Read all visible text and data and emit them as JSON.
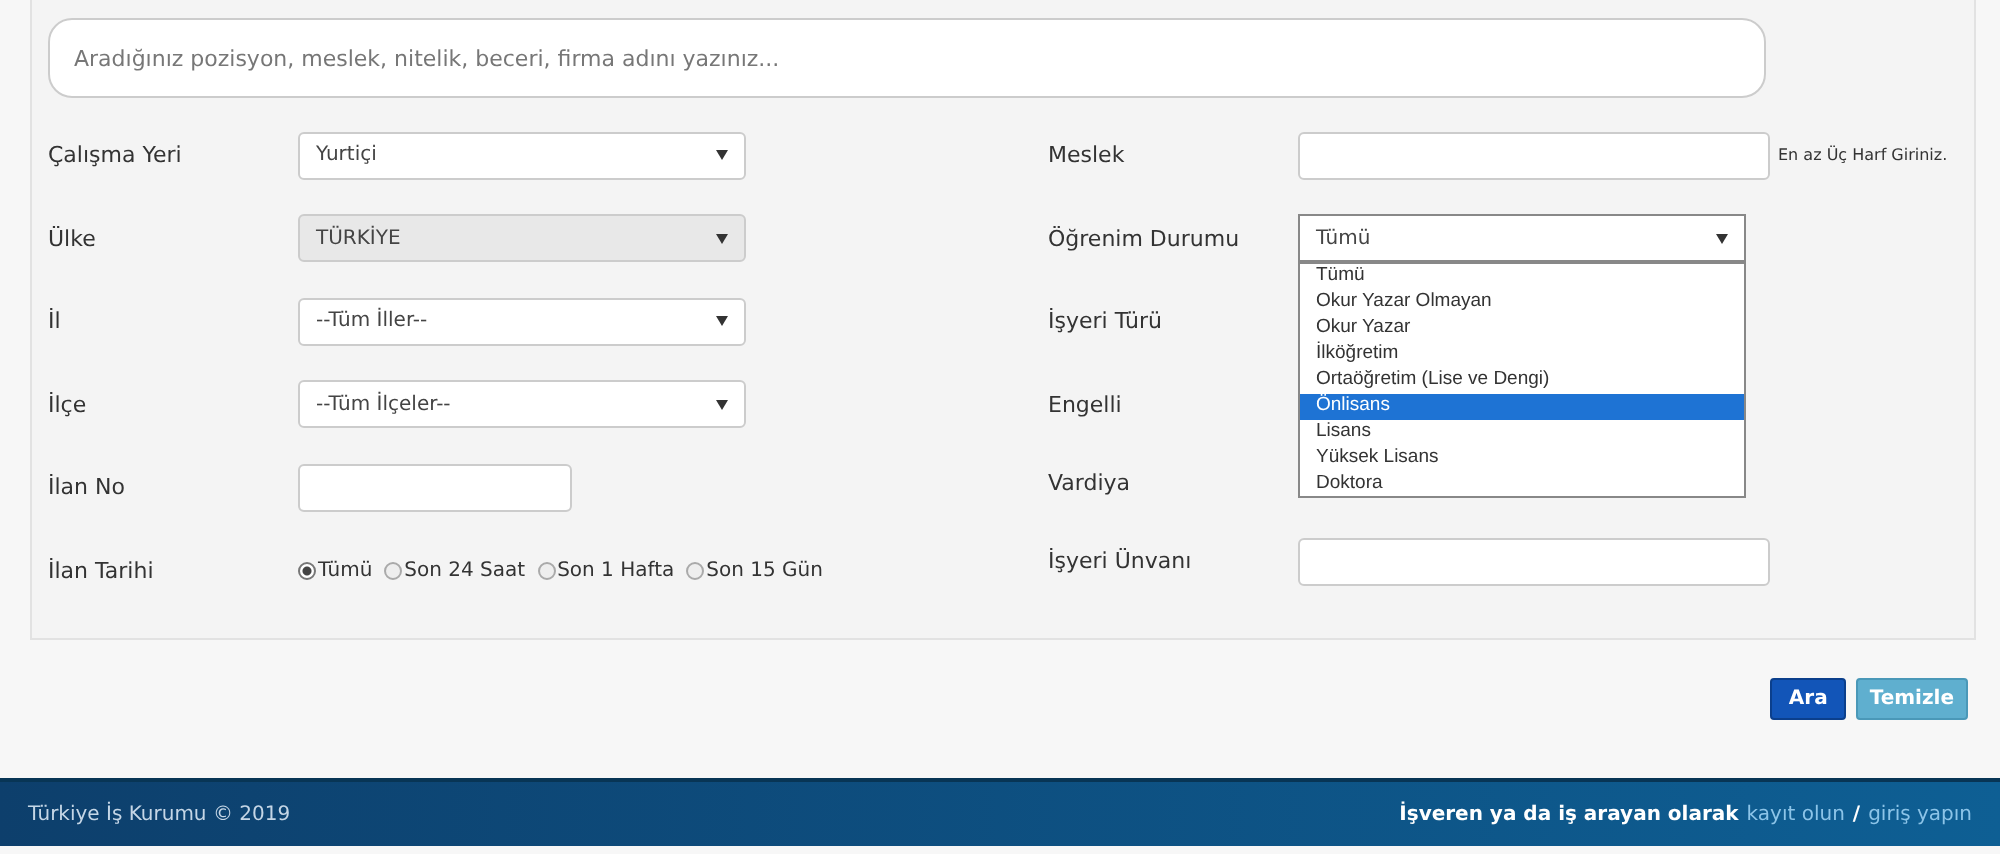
{
  "search": {
    "placeholder": "Aradığınız pozisyon, meslek, nitelik, beceri, firma adını yazınız..."
  },
  "left_fields": [
    {
      "label": "Çalışma Yeri",
      "kind": "select",
      "value": "Yurtiçi",
      "disabled": false
    },
    {
      "label": "Ülke",
      "kind": "select",
      "value": "TÜRKİYE",
      "disabled": true
    },
    {
      "label": "İl",
      "kind": "select",
      "value": "--Tüm İller--",
      "disabled": false
    },
    {
      "label": "İlçe",
      "kind": "select",
      "value": "--Tüm İlçeler--",
      "disabled": false
    },
    {
      "label": "İlan No",
      "kind": "input"
    },
    {
      "label": "İlan Tarihi",
      "kind": "radios",
      "options": [
        {
          "label": "Tümü",
          "selected": true
        },
        {
          "label": "Son 24 Saat",
          "selected": false
        },
        {
          "label": "Son 1 Hafta",
          "selected": false
        },
        {
          "label": "Son 15 Gün",
          "selected": false
        }
      ]
    }
  ],
  "right_fields": [
    {
      "label": "Meslek",
      "kind": "input",
      "hint": "En az Üç Harf Giriniz."
    },
    {
      "label": "Öğrenim Durumu",
      "kind": "select",
      "value": "Tümü",
      "expanded": true,
      "options": [
        {
          "label": "Tümü",
          "highlighted": false
        },
        {
          "label": "Okur Yazar Olmayan",
          "highlighted": false
        },
        {
          "label": "Okur Yazar",
          "highlighted": false
        },
        {
          "label": "İlköğretim",
          "highlighted": false
        },
        {
          "label": "Ortaöğretim (Lise ve Dengi)",
          "highlighted": false
        },
        {
          "label": "Önlisans",
          "highlighted": true
        },
        {
          "label": "Lisans",
          "highlighted": false
        },
        {
          "label": "Yüksek Lisans",
          "highlighted": false
        },
        {
          "label": "Doktora",
          "highlighted": false
        }
      ]
    },
    {
      "label": "İşyeri Türü",
      "kind": "hidden"
    },
    {
      "label": "Engelli",
      "kind": "hidden"
    },
    {
      "label": "Vardiya",
      "kind": "hidden"
    },
    {
      "label": "İşyeri Ünvanı",
      "kind": "input"
    }
  ],
  "buttons": [
    {
      "label": "Ara",
      "kind": "primary"
    },
    {
      "label": "Temizle",
      "kind": "secondary"
    }
  ],
  "footer": {
    "copyright": "Türkiye İş Kurumu © 2019",
    "prompt": "İşveren ya da iş arayan olarak",
    "register_link": "kayıt olun",
    "separator": "/",
    "login_link": "giriş yapın"
  }
}
